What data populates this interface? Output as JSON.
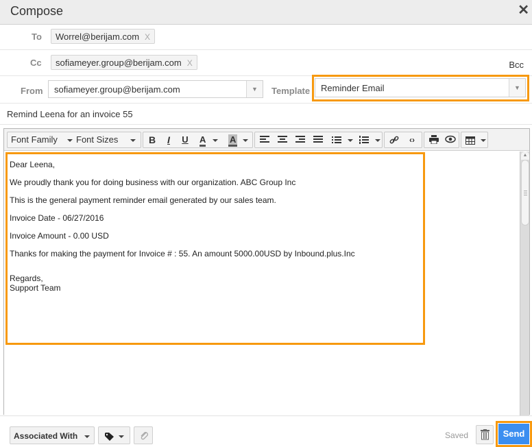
{
  "header": {
    "title": "Compose",
    "close_icon": "close-icon"
  },
  "recipients": {
    "to_label": "To",
    "to": [
      {
        "email": "Worrel@berijam.com",
        "remove": "X"
      }
    ],
    "cc_label": "Cc",
    "cc": [
      {
        "email": "sofiameyer.group@berijam.com",
        "remove": "X"
      }
    ],
    "bcc_label": "Bcc"
  },
  "from": {
    "label": "From",
    "value": "sofiameyer.group@berijam.com"
  },
  "template": {
    "label": "Template",
    "value": "Reminder Email"
  },
  "subject": "Remind Leena for an invoice 55",
  "toolbar": {
    "font_family": "Font Family",
    "font_sizes": "Font Sizes",
    "bold": "B",
    "italic": "I",
    "underline": "U",
    "text_color": "A",
    "bg_color": "A"
  },
  "body": {
    "greeting": "Dear Leena,",
    "line1": "We proudly thank you for doing business with our organization. ABC Group Inc",
    "line2": "This is the general payment reminder email generated by our sales team.",
    "line3": "Invoice Date - 06/27/2016",
    "line4": "Invoice Amount - 0.00 USD",
    "line5": "Thanks for making the payment for Invoice # : 55. An amount 5000.00USD by Inbound.plus.Inc",
    "closing": "Regards,",
    "signature": "Support Team"
  },
  "footer": {
    "associated_with": "Associated With",
    "saved": "Saved",
    "send": "Send"
  },
  "colors": {
    "highlight": "#f7990f",
    "send_button": "#3b8ef0"
  }
}
